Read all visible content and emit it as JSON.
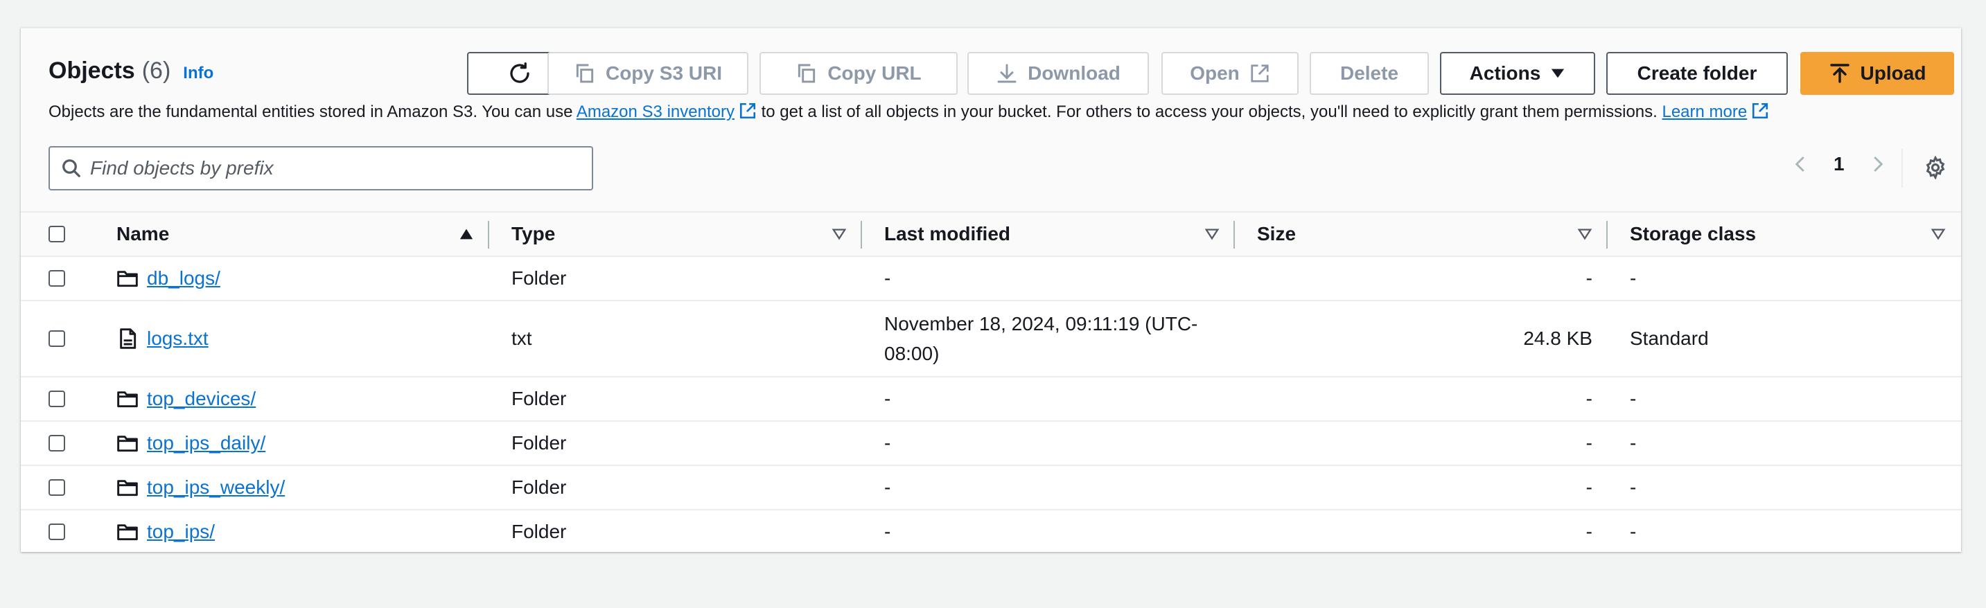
{
  "header": {
    "title": "Objects",
    "count": "(6)",
    "info": "Info",
    "description_prefix": "Objects are the fundamental entities stored in Amazon S3. You can use ",
    "inventory_link": "Amazon S3 inventory",
    "description_middle": " to get a list of all objects in your bucket. For others to access your objects, you'll need to explicitly grant them permissions. ",
    "learn_more": "Learn more"
  },
  "toolbar": {
    "copy_s3_uri": "Copy S3 URI",
    "copy_url": "Copy URL",
    "download": "Download",
    "open": "Open",
    "delete": "Delete",
    "actions": "Actions",
    "create_folder": "Create folder",
    "upload": "Upload"
  },
  "search": {
    "placeholder": "Find objects by prefix"
  },
  "pagination": {
    "page": "1"
  },
  "table": {
    "columns": {
      "name": "Name",
      "type": "Type",
      "last_modified": "Last modified",
      "size": "Size",
      "storage_class": "Storage class"
    },
    "rows": [
      {
        "name": "db_logs/",
        "icon": "folder-icon",
        "type": "Folder",
        "last_modified": "-",
        "size": "-",
        "storage_class": "-"
      },
      {
        "name": "logs.txt",
        "icon": "file-icon",
        "type": "txt",
        "last_modified": "November 18, 2024, 09:11:19 (UTC-08:00)",
        "size": "24.8 KB",
        "storage_class": "Standard"
      },
      {
        "name": "top_devices/",
        "icon": "folder-icon",
        "type": "Folder",
        "last_modified": "-",
        "size": "-",
        "storage_class": "-"
      },
      {
        "name": "top_ips_daily/",
        "icon": "folder-icon",
        "type": "Folder",
        "last_modified": "-",
        "size": "-",
        "storage_class": "-"
      },
      {
        "name": "top_ips_weekly/",
        "icon": "folder-icon",
        "type": "Folder",
        "last_modified": "-",
        "size": "-",
        "storage_class": "-"
      },
      {
        "name": "top_ips/",
        "icon": "folder-icon",
        "type": "Folder",
        "last_modified": "-",
        "size": "-",
        "storage_class": "-"
      }
    ]
  },
  "colors": {
    "link": "#0972d3",
    "primary": "#f4a136",
    "disabled_text": "#8d99a8"
  }
}
